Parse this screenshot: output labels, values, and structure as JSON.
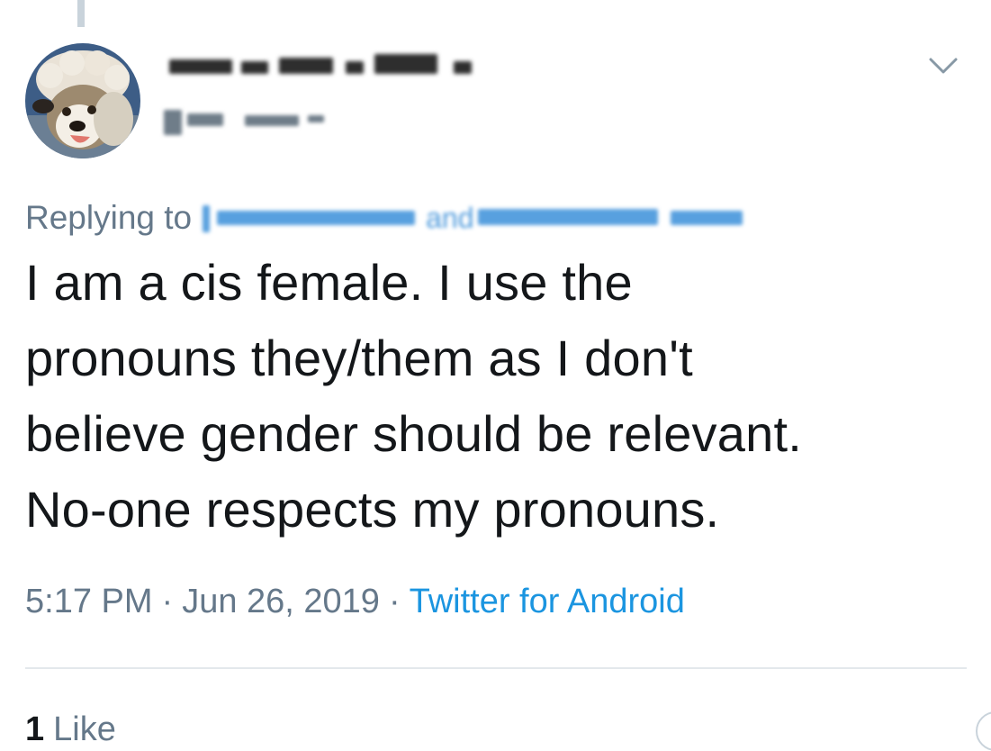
{
  "tweet": {
    "author": {
      "avatar_icon": "avatar-dog-in-sheep-hat-icon"
    },
    "menu_icon": "chevron-down-icon",
    "replying_to_label": "Replying to",
    "replying_to_connector": "and",
    "text": "I am a cis female.  I use the\npronouns they/them as I don't\nbelieve gender should be relevant.\nNo-one respects my pronouns.",
    "time": "5:17 PM",
    "separator": "·",
    "date": "Jun 26, 2019",
    "source": "Twitter for Android",
    "likes_count": "1",
    "likes_label": "Like"
  },
  "colors": {
    "text_primary": "#14171a",
    "text_secondary": "#65788a",
    "link": "#1b95e0",
    "divider": "#e3e8ec"
  }
}
